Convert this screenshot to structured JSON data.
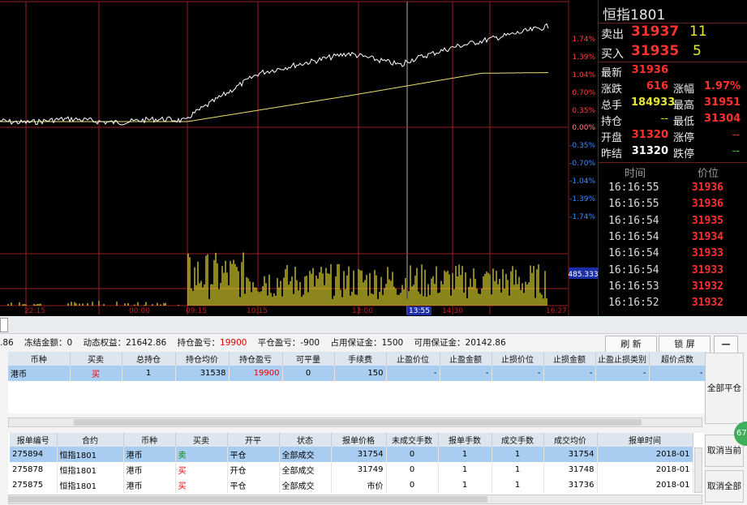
{
  "chart_data": {
    "type": "line",
    "axis_right_labels": [
      "1.74%",
      "1.39%",
      "1.04%",
      "0.70%",
      "0.35%",
      "0.00%",
      "-0.35%",
      "-0.70%",
      "-1.04%",
      "-1.39%",
      "-1.74%"
    ],
    "x_tick_labels": [
      "22:15",
      "00:00",
      "09:15",
      "10:15",
      "13:00",
      "13:55",
      "14:30",
      "16:27"
    ],
    "volume_label": "485.333",
    "grid": true
  },
  "side": {
    "title": "恒指1801",
    "sell_label": "卖出",
    "sell_price": "31937",
    "sell_qty": "11",
    "buy_label": "买入",
    "buy_price": "31935",
    "buy_qty": "5",
    "latest_label": "最新",
    "latest_value": "31936",
    "change_label": "涨跌",
    "change_value": "616",
    "change_pct_label": "涨幅",
    "change_pct_value": "1.97%",
    "volume_label": "总手",
    "volume_value": "184933",
    "high_label": "最高",
    "high_value": "31951",
    "oi_label": "持仓",
    "oi_value": "--",
    "low_label": "最低",
    "low_value": "31304",
    "open_label": "开盘",
    "open_value": "31320",
    "limit_up_label": "涨停",
    "limit_up_value": "--",
    "prev_label": "昨结",
    "prev_value": "31320",
    "limit_down_label": "跌停",
    "limit_down_value": "--",
    "ticks_time_header": "时间",
    "ticks_price_header": "价位",
    "ticks": [
      {
        "time": "16:16:55",
        "price": "31936"
      },
      {
        "time": "16:16:55",
        "price": "31936"
      },
      {
        "time": "16:16:54",
        "price": "31935"
      },
      {
        "time": "16:16:54",
        "price": "31934"
      },
      {
        "time": "16:16:54",
        "price": "31933"
      },
      {
        "time": "16:16:54",
        "price": "31933"
      },
      {
        "time": "16:16:53",
        "price": "31932"
      },
      {
        "time": "16:16:52",
        "price": "31932"
      }
    ]
  },
  "account": {
    "balance_tail": ".86",
    "frozen": "冻结金额：0",
    "equity": "动态权益：21642.86",
    "position_pl_label": "持仓盈亏：",
    "position_pl_value": "19900",
    "close_pl": "平仓盈亏：-900",
    "margin": "占用保证金：1500",
    "available": "可用保证金：20142.86",
    "refresh": "刷  新",
    "lock": "锁  屏",
    "minimize": "—"
  },
  "positions": {
    "headers": [
      "币种",
      "买卖",
      "总持仓",
      "持仓均价",
      "持仓盈亏",
      "可平量",
      "手续费",
      "止盈价位",
      "止盈金额",
      "止损价位",
      "止损金额",
      "止盈止损类别",
      "超价点数"
    ],
    "rows": [
      {
        "currency": "港币",
        "side": "买",
        "total": "1",
        "avg": "31538",
        "pl": "19900",
        "closable": "0",
        "fee": "150",
        "tp_price": "-",
        "tp_amount": "-",
        "sl_price": "-",
        "sl_amount": "-",
        "type": "-",
        "ticks": "-"
      }
    ],
    "close_all": "全部平仓"
  },
  "orders": {
    "headers": [
      "报单编号",
      "合约",
      "币种",
      "买卖",
      "开平",
      "状态",
      "报单价格",
      "未成交手数",
      "报单手数",
      "成交手数",
      "成交均价",
      "报单时间"
    ],
    "rows": [
      {
        "id": "275894",
        "contract": "恒指1801",
        "currency": "港币",
        "side": "卖",
        "oc": "平仓",
        "status": "全部成交",
        "price": "31754",
        "unfilled": "0",
        "qty": "1",
        "filled": "1",
        "avg": "31754",
        "time": "2018-01"
      },
      {
        "id": "275878",
        "contract": "恒指1801",
        "currency": "港币",
        "side": "买",
        "oc": "开仓",
        "status": "全部成交",
        "price": "31749",
        "unfilled": "0",
        "qty": "1",
        "filled": "1",
        "avg": "31748",
        "time": "2018-01"
      },
      {
        "id": "275875",
        "contract": "恒指1801",
        "currency": "港币",
        "side": "买",
        "oc": "平仓",
        "status": "全部成交",
        "price": "市价",
        "unfilled": "0",
        "qty": "1",
        "filled": "1",
        "avg": "31736",
        "time": "2018-01"
      }
    ],
    "cancel_current": "取消当前",
    "cancel_all": "取消全部",
    "badge": "67"
  }
}
